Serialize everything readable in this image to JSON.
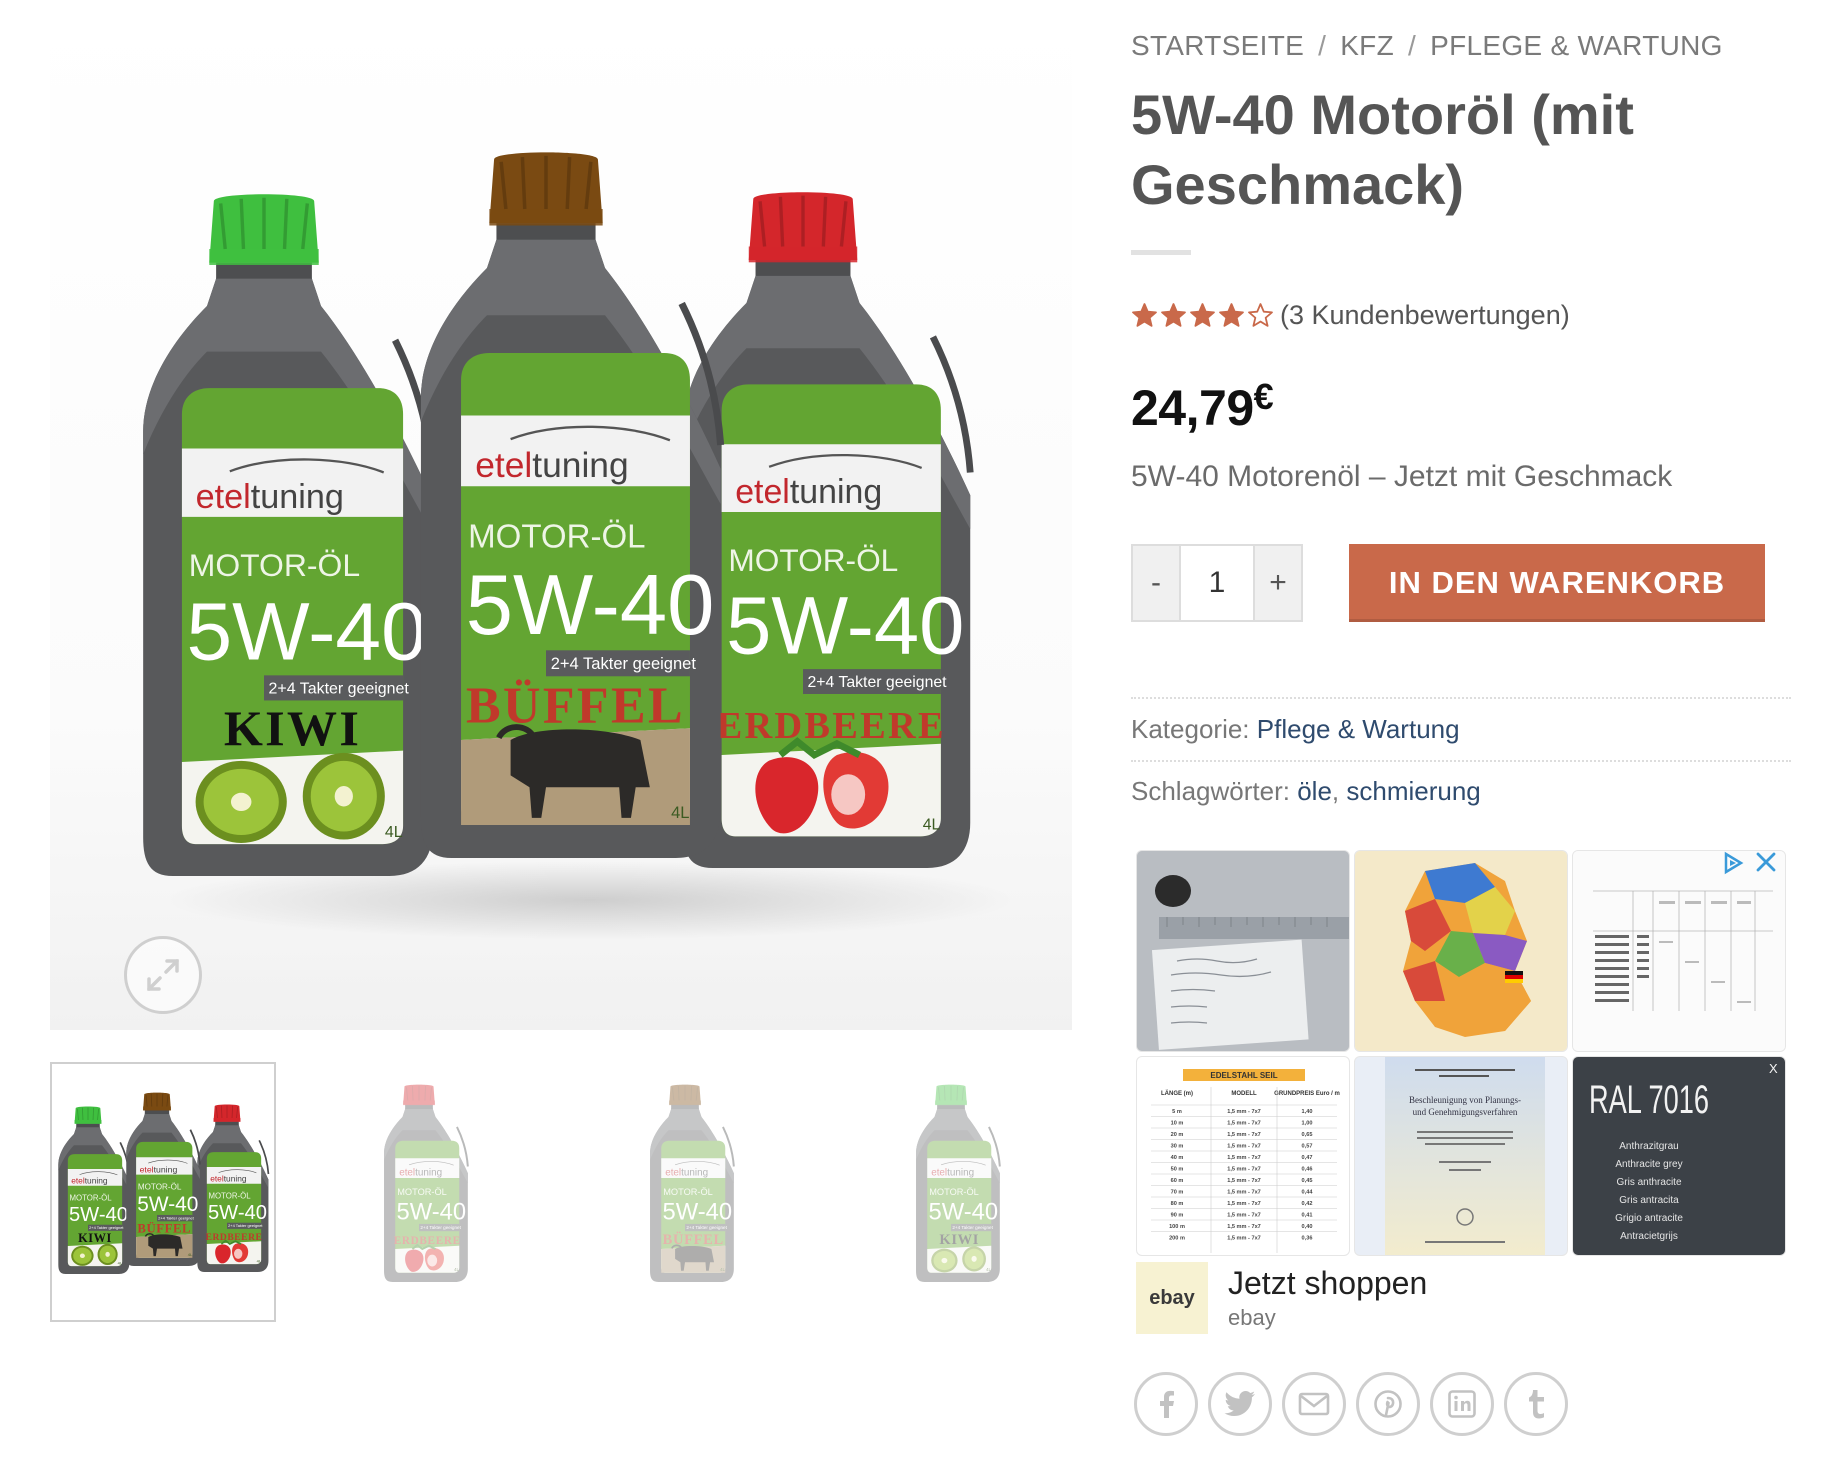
{
  "breadcrumb": {
    "items": [
      "STARTSEITE",
      "KFZ",
      "PFLEGE & WARTUNG"
    ],
    "separator": "/"
  },
  "product": {
    "title": "5W-40 Motoröl (mit Geschmack)",
    "rating_value": 4,
    "rating_max": 5,
    "rating_text": "(3 Kundenbewertungen)",
    "price_amount": "24,79",
    "price_currency": "€",
    "short_description": "5W-40 Motorenöl – Jetzt mit Geschmack",
    "quantity": "1",
    "add_to_cart_label": "IN DEN WARENKORB"
  },
  "meta": {
    "category_label": "Kategorie:",
    "category_value": "Pflege & Wartung",
    "tags_label": "Schlagwörter:",
    "tags": [
      "öle",
      "schmierung"
    ],
    "tags_separator": ", "
  },
  "bottles": {
    "brand_a": "etel",
    "brand_b": "tuning",
    "product_line": "MOTOR-ÖL",
    "viscosity": "5W-40",
    "subline": "2+4 Takter geeignet",
    "volume": "4L",
    "flavors": [
      {
        "name": "KIWI",
        "cap_color": "#3fbf3f"
      },
      {
        "name": "BÜFFEL",
        "cap_color": "#7a4a12"
      },
      {
        "name": "ERDBEERE",
        "cap_color": "#d4262b"
      }
    ]
  },
  "thumbnails": [
    {
      "flavor": "group",
      "active": true
    },
    {
      "flavor": "ERDBEERE",
      "active": false
    },
    {
      "flavor": "BÜFFEL",
      "active": false
    },
    {
      "flavor": "KIWI",
      "active": false
    }
  ],
  "ad": {
    "table_title": "EDELSTAHL SEIL",
    "table_headers": [
      "LÄNGE (m)",
      "MODELL",
      "GRUNDPREIS Euro / m"
    ],
    "table_rows": [
      [
        "5 m",
        "1,5 mm - 7x7",
        "1,40"
      ],
      [
        "10 m",
        "1,5 mm - 7x7",
        "1,00"
      ],
      [
        "20 m",
        "1,5 mm - 7x7",
        "0,65"
      ],
      [
        "30 m",
        "1,5 mm - 7x7",
        "0,57"
      ],
      [
        "40 m",
        "1,5 mm - 7x7",
        "0,47"
      ],
      [
        "50 m",
        "1,5 mm - 7x7",
        "0,46"
      ],
      [
        "60 m",
        "1,5 mm - 7x7",
        "0,45"
      ],
      [
        "70 m",
        "1,5 mm - 7x7",
        "0,44"
      ],
      [
        "80 m",
        "1,5 mm - 7x7",
        "0,42"
      ],
      [
        "90 m",
        "1,5 mm - 7x7",
        "0,41"
      ],
      [
        "100 m",
        "1,5 mm - 7x7",
        "0,40"
      ],
      [
        "200 m",
        "1,5 mm - 7x7",
        "0,36"
      ]
    ],
    "book_title": "Beschleunigung von Planungs- und Genehmigungsverfahren",
    "ral_title": "RAL 7016",
    "ral_names": [
      "Anthrazitgrau",
      "Anthracite grey",
      "Gris anthracite",
      "Gris antracita",
      "Grigio antracite",
      "Antracietgrijs"
    ],
    "ral_close": "X",
    "cta": "Jetzt shoppen",
    "source": "ebay",
    "logo_text": "ebay"
  },
  "share": {
    "icons": [
      "facebook-icon",
      "twitter-icon",
      "email-icon",
      "pinterest-icon",
      "linkedin-icon",
      "tumblr-icon"
    ]
  },
  "colors": {
    "accent_button": "#c9694a",
    "link": "#2f4b6e",
    "star": "#c9694a",
    "label_green": "#63a532"
  }
}
